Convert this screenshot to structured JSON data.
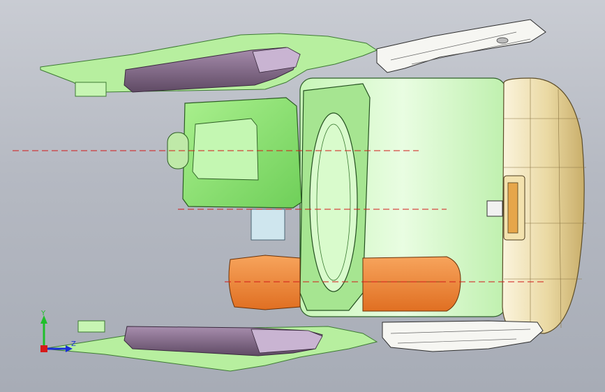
{
  "viewport": {
    "background_top": "#c9ccd3",
    "background_bottom": "#a7acb6"
  },
  "triad": {
    "y_label": "Y",
    "z_label": "Z",
    "y_color": "#1fbf2a",
    "z_color": "#1a2fd6",
    "x_color": "#d61a1a"
  },
  "colors": {
    "body_green": "#b9f2a8",
    "body_green_dark": "#56a54a",
    "pad_purple": "#8c7391",
    "pad_purple_light": "#c7b2cf",
    "cap_beige": "#e9d9a7",
    "orange_tank": "#f28a3c",
    "centerline_red": "#d21a1a",
    "white_part": "#f4f4f2"
  }
}
